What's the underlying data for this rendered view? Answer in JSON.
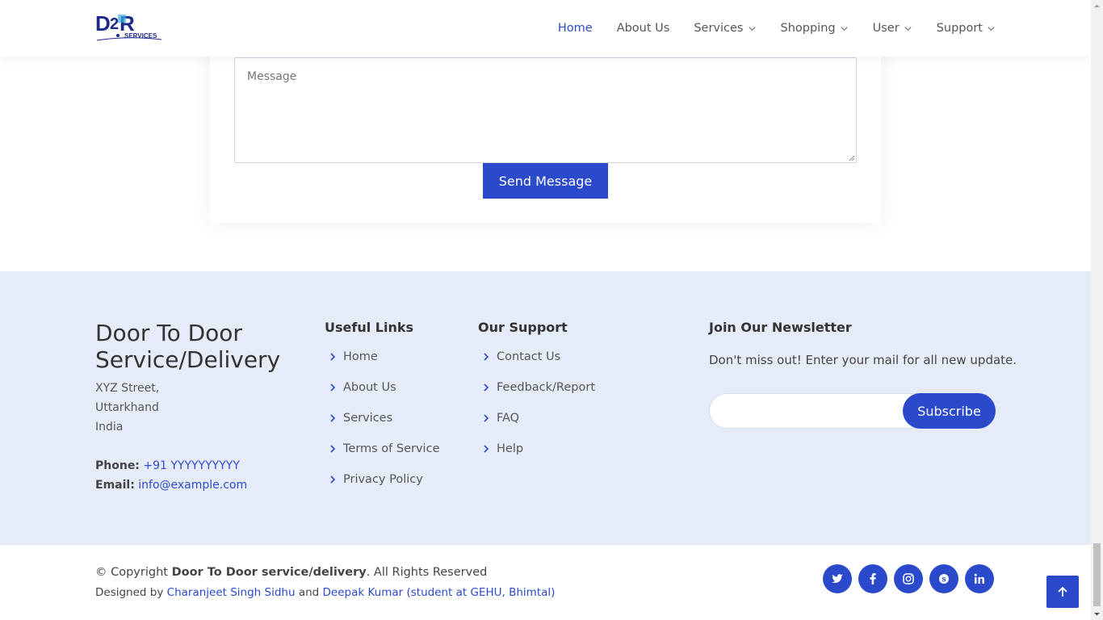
{
  "logo": {
    "text": "D2DR",
    "sub": "SERVICES"
  },
  "nav": {
    "items": [
      {
        "label": "Home",
        "active": true,
        "dropdown": false
      },
      {
        "label": "About Us",
        "active": false,
        "dropdown": false
      },
      {
        "label": "Services",
        "active": false,
        "dropdown": true
      },
      {
        "label": "Shopping",
        "active": false,
        "dropdown": true
      },
      {
        "label": "User",
        "active": false,
        "dropdown": true
      },
      {
        "label": "Support",
        "active": false,
        "dropdown": true
      }
    ]
  },
  "contact_form": {
    "message_placeholder": "Message",
    "send_label": "Send Message"
  },
  "footer": {
    "brand_line1": "Door To Door",
    "brand_line2": "Service/Delivery",
    "address": [
      "XYZ Street,",
      "Uttarkhand",
      "India"
    ],
    "phone_label": "Phone:",
    "phone_value": "+91 YYYYYYYYYY",
    "email_label": "Email:",
    "email_value": "info@example.com",
    "useful_links_title": "Useful Links",
    "useful_links": [
      "Home",
      "About Us",
      "Services",
      "Terms of Service",
      "Privacy Policy"
    ],
    "support_title": "Our Support",
    "support_links": [
      "Contact Us",
      "Feedback/Report",
      "FAQ",
      "Help"
    ],
    "newsletter_title": "Join Our Newsletter",
    "newsletter_text": "Don't miss out! Enter your mail for all new update.",
    "subscribe_label": "Subscribe"
  },
  "bottom": {
    "copyright_prefix": "© Copyright ",
    "copyright_name": "Door To Door service/delivery",
    "copyright_suffix": ". All Rights Reserved",
    "designed_by": "Designed by ",
    "designer1": "Charanjeet Singh Sidhu",
    "and": " and ",
    "designer2": "Deepak Kumar (student at GEHU, Bhimtal)",
    "socials": [
      "twitter-icon",
      "facebook-icon",
      "instagram-icon",
      "skype-icon",
      "linkedin-icon"
    ]
  },
  "colors": {
    "accent": "#2b4acb",
    "footer_bg": "#e5ebf7"
  }
}
